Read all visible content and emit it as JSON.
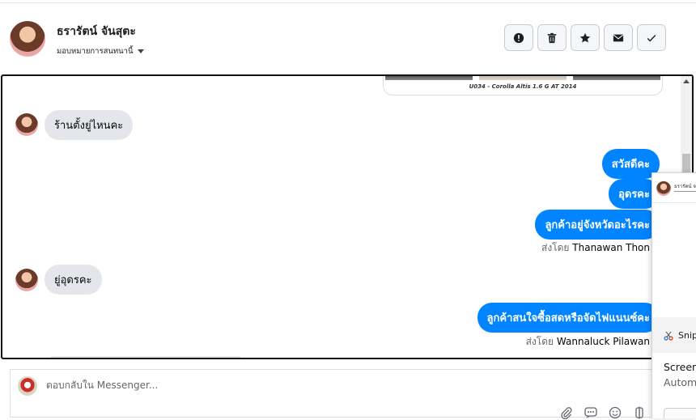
{
  "header": {
    "contact_name": "ธรารัตน์ จันสุตะ",
    "assign_label": "มอบหมายการสนทนานี้",
    "actions": [
      {
        "name": "alert-button",
        "icon": "exclamation-circle-icon"
      },
      {
        "name": "delete-button",
        "icon": "trash-icon"
      },
      {
        "name": "star-button",
        "icon": "star-icon"
      },
      {
        "name": "mark-unread-button",
        "icon": "envelope-icon"
      },
      {
        "name": "mark-done-button",
        "icon": "checkmark-icon"
      }
    ]
  },
  "chat": {
    "car_card_caption": "U034 - Corolla Altis 1.6 G AT 2014",
    "messages": [
      {
        "direction": "in",
        "text": "ร้านตั้งยู่ไหนคะ"
      },
      {
        "direction": "out",
        "text": "สวัสดีคะ"
      },
      {
        "direction": "out",
        "text": "อุดรคะ"
      },
      {
        "direction": "out",
        "text": "ลูกค้าอยู่จังหวัดอะไรคะ"
      },
      {
        "direction": "in",
        "text": "ยู่อุดรคะ"
      },
      {
        "direction": "out",
        "text": "ลูกค้าสนใจซื้อสดหรือจัดไฟแนนซ์คะ"
      }
    ],
    "sent_by_prefix": "ส่งโดย",
    "sent_by_1": "Thanawan Thon",
    "sent_by_2": "Wannaluck Pilawan"
  },
  "reply": {
    "placeholder": "ตอบกลับใน Messenger...",
    "tools": [
      "paperclip-icon",
      "saved-reply-icon",
      "emoji-icon",
      "more-icon"
    ]
  },
  "snip_popup": {
    "mini_name": "ธรารัตน์ จ",
    "app_name": "Snipping Tool",
    "title": "Screenshot copied to clipboard",
    "subtitle": "Automatically saved to screenshots folder"
  }
}
